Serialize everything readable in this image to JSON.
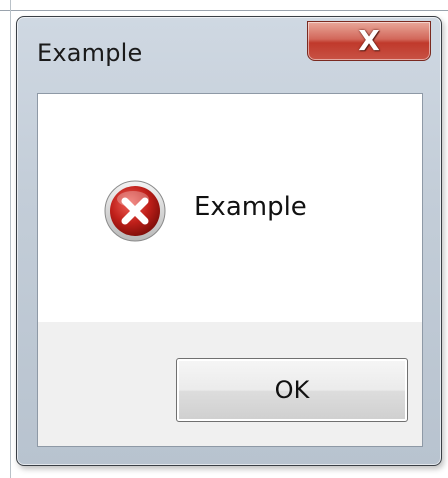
{
  "window": {
    "title": "Example",
    "close_glyph": "X"
  },
  "dialog": {
    "icon": "error-icon",
    "message": "Example",
    "ok_label": "OK"
  },
  "colors": {
    "close_button": "#c85345",
    "error_icon": "#c0201a",
    "button_area": "#f0f0f0"
  }
}
